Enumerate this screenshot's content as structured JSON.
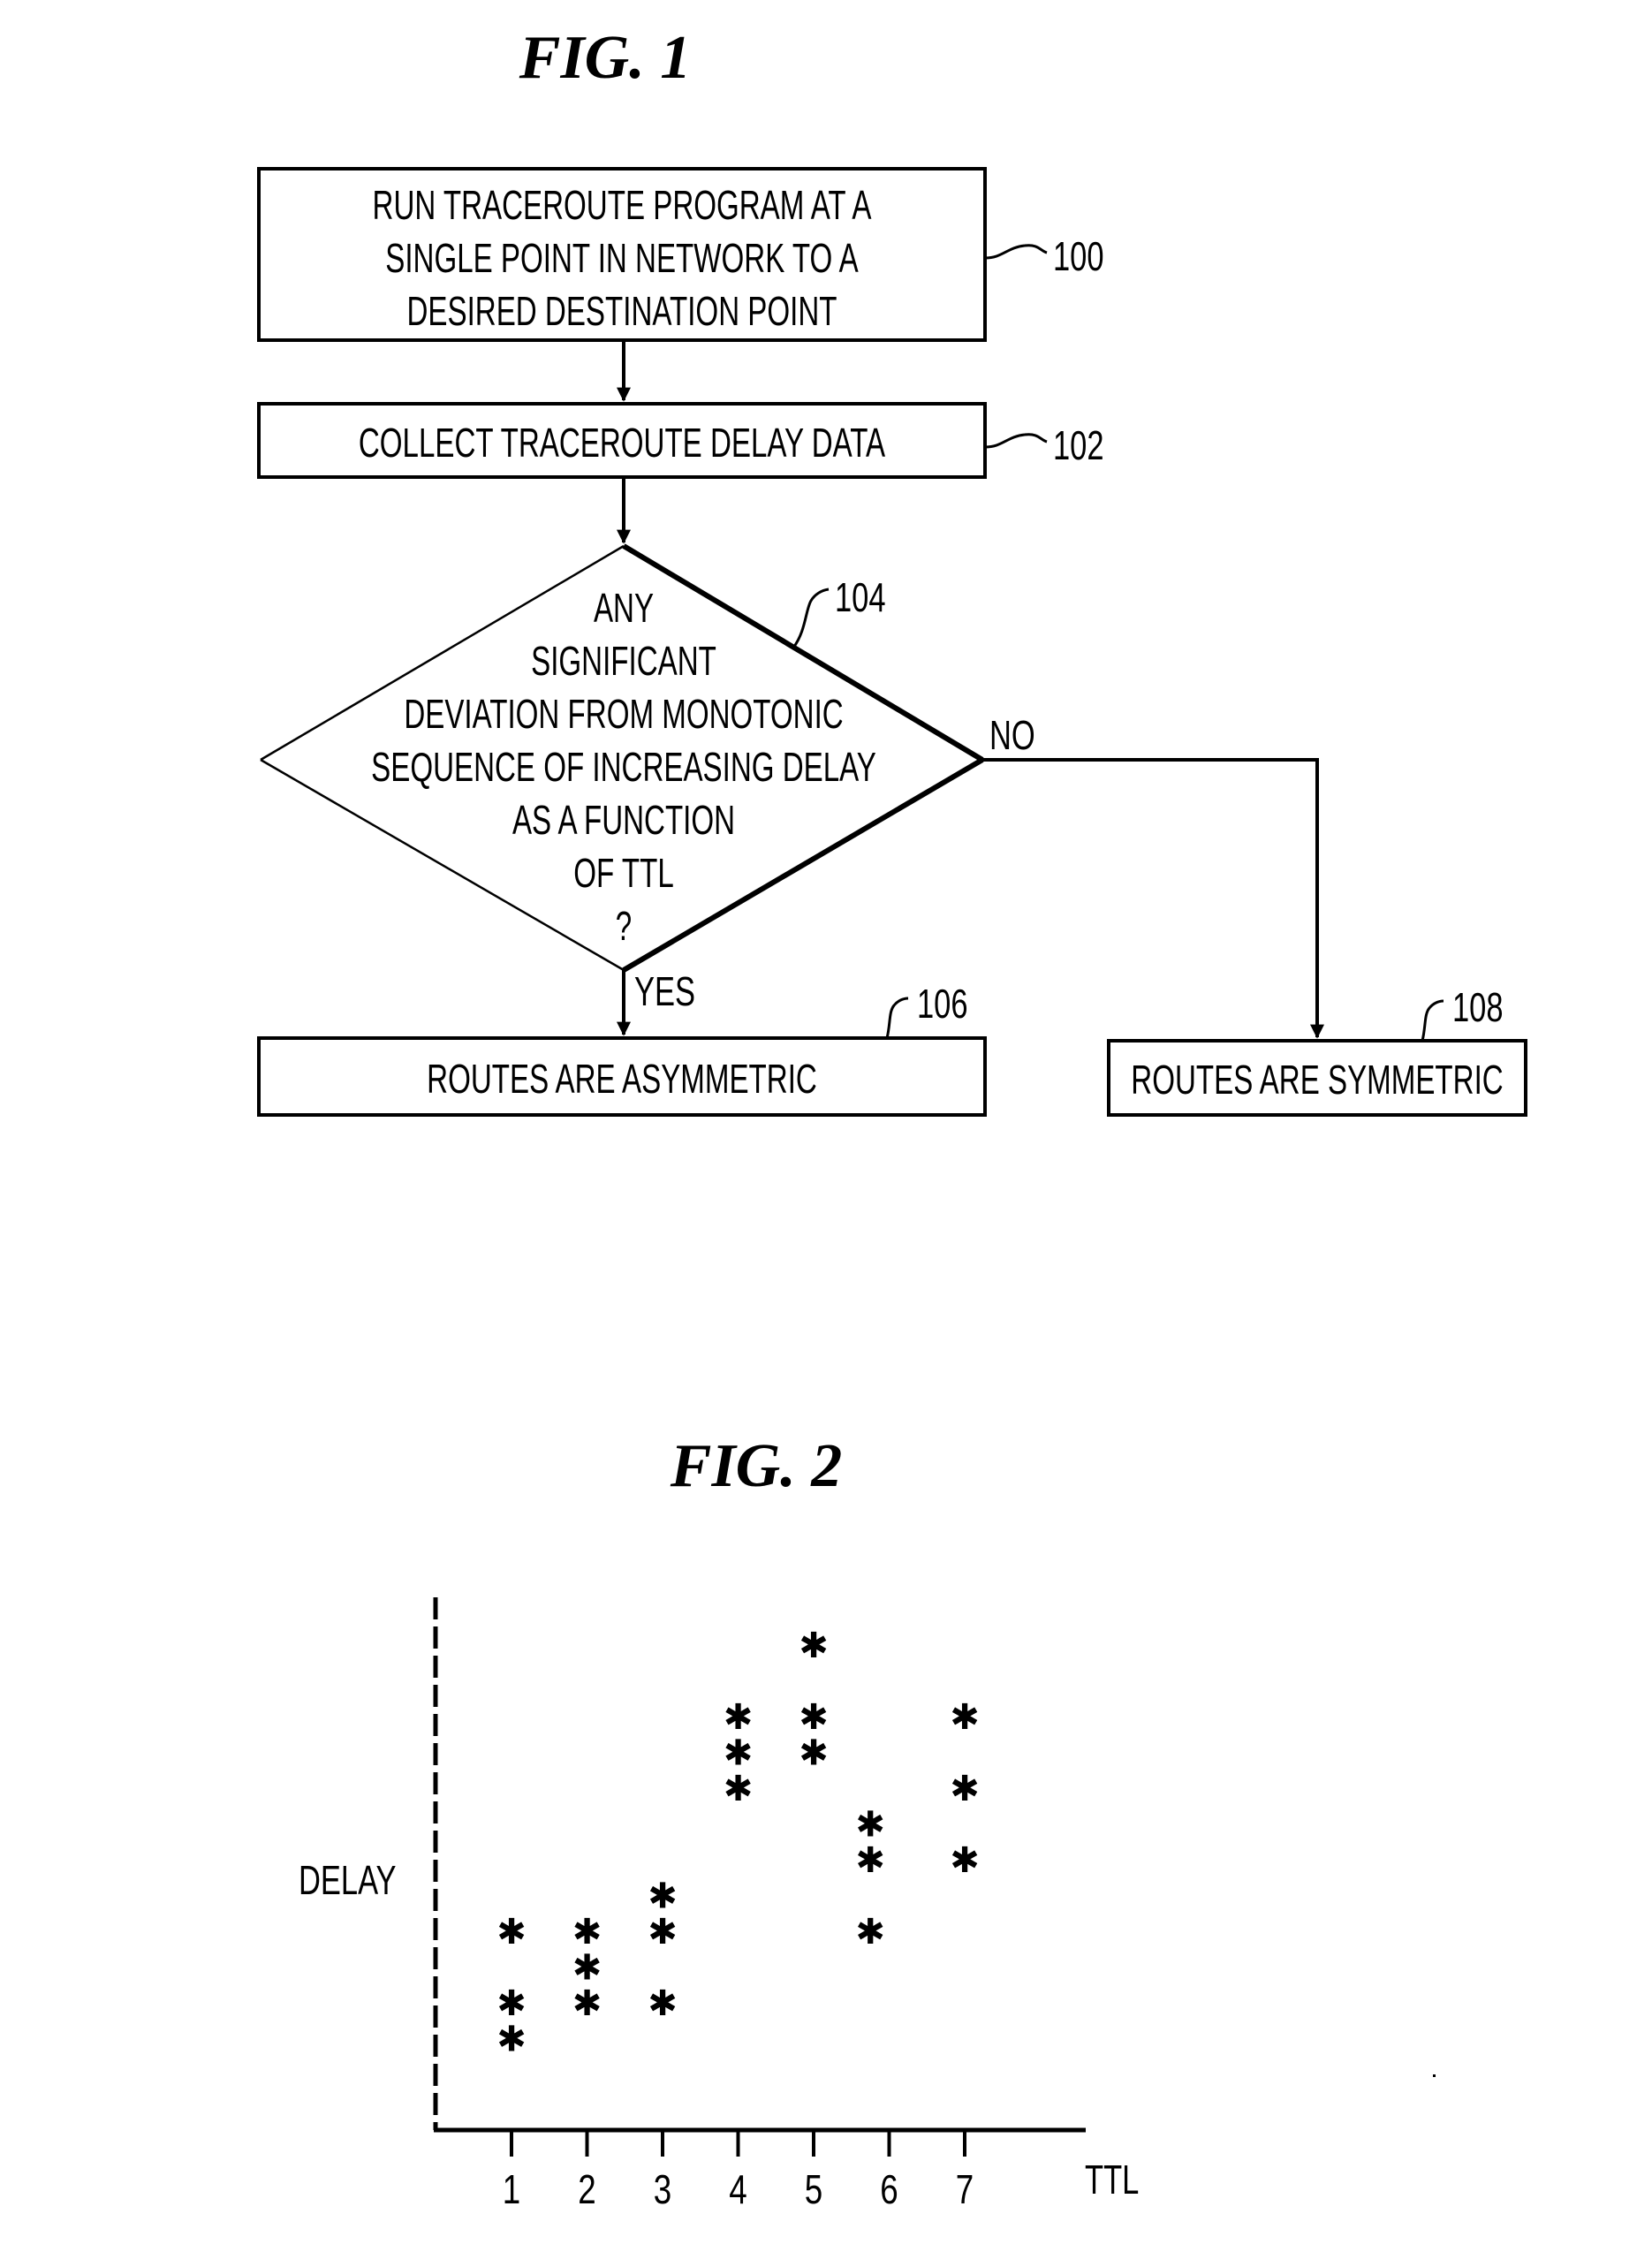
{
  "figure1": {
    "title": "FIG. 1",
    "steps": [
      {
        "ref": "100",
        "lines": [
          "RUN TRACEROUTE PROGRAM AT A",
          "SINGLE POINT IN NETWORK TO A",
          "DESIRED DESTINATION POINT"
        ]
      },
      {
        "ref": "102",
        "lines": [
          "COLLECT TRACEROUTE DELAY DATA"
        ]
      }
    ],
    "decision": {
      "ref": "104",
      "lines": [
        "ANY",
        "SIGNIFICANT",
        "DEVIATION FROM MONOTONIC",
        "SEQUENCE OF INCREASING DELAY",
        "AS A FUNCTION",
        "OF TTL",
        "?"
      ],
      "yes_label": "YES",
      "no_label": "NO"
    },
    "outcomes": {
      "yes": {
        "ref": "106",
        "label": "ROUTES ARE ASYMMETRIC"
      },
      "no": {
        "ref": "108",
        "label": "ROUTES ARE SYMMETRIC"
      }
    }
  },
  "figure2": {
    "title": "FIG. 2"
  },
  "chart_data": {
    "type": "scatter",
    "title": "FIG. 2",
    "xlabel": "TTL",
    "ylabel": "DELAY",
    "x_ticks": [
      "1",
      "2",
      "3",
      "4",
      "5",
      "6",
      "7"
    ],
    "xlim": [
      0,
      8.5
    ],
    "ylim": [
      0,
      15
    ],
    "grid": false,
    "marker": "*",
    "y_axis_style": "dashed",
    "y_units": "arbitrary (unlabeled axis)",
    "points": [
      {
        "x": 1,
        "y": 5.6
      },
      {
        "x": 1,
        "y": 3.6
      },
      {
        "x": 1,
        "y": 2.6
      },
      {
        "x": 2,
        "y": 5.6
      },
      {
        "x": 2,
        "y": 4.6
      },
      {
        "x": 2,
        "y": 3.6
      },
      {
        "x": 3,
        "y": 6.6
      },
      {
        "x": 3,
        "y": 5.6
      },
      {
        "x": 3,
        "y": 3.6
      },
      {
        "x": 4,
        "y": 11.6
      },
      {
        "x": 4,
        "y": 10.6
      },
      {
        "x": 4,
        "y": 9.6
      },
      {
        "x": 5,
        "y": 13.6
      },
      {
        "x": 5,
        "y": 11.6
      },
      {
        "x": 5,
        "y": 10.6
      },
      {
        "x": 5.75,
        "y": 8.6
      },
      {
        "x": 5.75,
        "y": 7.6
      },
      {
        "x": 5.75,
        "y": 5.6
      },
      {
        "x": 7,
        "y": 11.6
      },
      {
        "x": 7,
        "y": 9.6
      },
      {
        "x": 7,
        "y": 7.6
      }
    ]
  }
}
